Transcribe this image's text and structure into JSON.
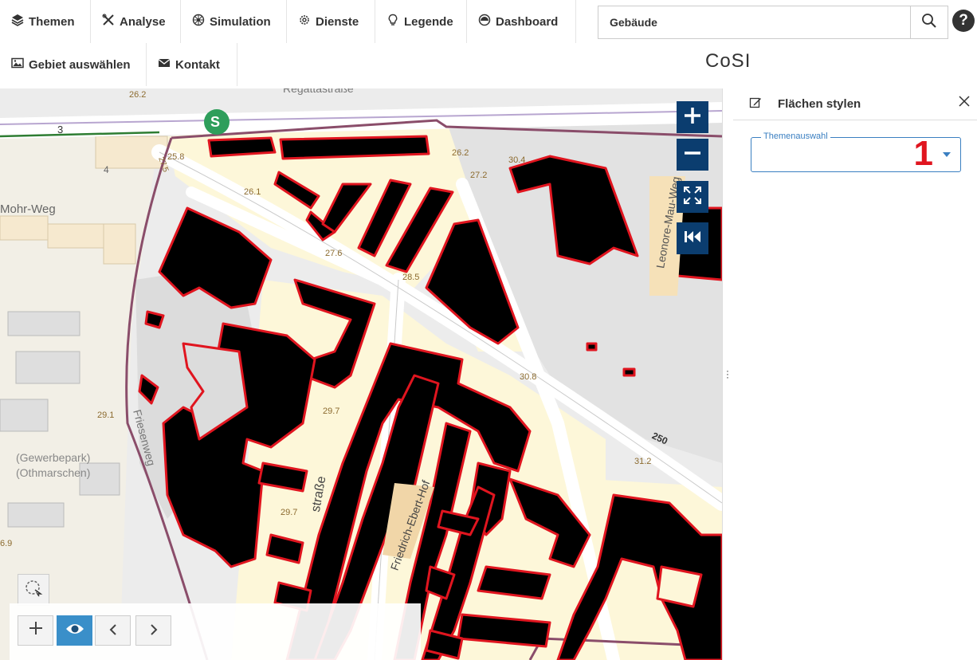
{
  "nav": {
    "items": [
      {
        "label": "Themen",
        "icon": "layers-icon"
      },
      {
        "label": "Analyse",
        "icon": "tools-icon"
      },
      {
        "label": "Simulation",
        "icon": "network-icon"
      },
      {
        "label": "Dienste",
        "icon": "gear-icon"
      },
      {
        "label": "Legende",
        "icon": "lightbulb-icon"
      },
      {
        "label": "Dashboard",
        "icon": "speedometer-icon"
      },
      {
        "label": "Gebiet auswählen",
        "icon": "image-icon"
      },
      {
        "label": "Kontakt",
        "icon": "envelope-icon"
      }
    ],
    "search": {
      "value": "Gebäude"
    },
    "help_label": "?"
  },
  "app_title": "CoSI",
  "map": {
    "labels": {
      "street1": "Friedrich-Ebert-Hof",
      "street2": "straße",
      "street3": "Leonore-Mau-Weg",
      "street4": "Mohr-Weg",
      "street5": "Friesenweg",
      "area1": "(Gewerbepark)",
      "area2": "(Othmarschen)",
      "street_top": "Regattastraße",
      "s_bahn": "S"
    },
    "spot_heights": [
      "26.2",
      "26.2",
      "25.8",
      "27.2",
      "30.4",
      "26.1",
      "27.6",
      "28.5",
      "30.8",
      "29.1",
      "29.7",
      "29.7",
      "31.2",
      "250",
      "6.9",
      "3",
      "4",
      "27.5"
    ],
    "controls": {
      "zoom_in": "+",
      "zoom_out": "−"
    }
  },
  "panel": {
    "title": "Flächen stylen",
    "icon": "edit-icon",
    "field_legend": "Themenauswahl",
    "field_value": "",
    "badge": "1"
  },
  "footer": {
    "buttons": [
      "plus-icon",
      "eye-icon",
      "chevron-left-icon",
      "chevron-right-icon"
    ]
  },
  "colors": {
    "building_fill": "#000000",
    "building_outline": "#e0151f",
    "residential": "#fdf7d9",
    "nav_blue": "#0b3d6f",
    "accent": "#3a7fc1"
  }
}
